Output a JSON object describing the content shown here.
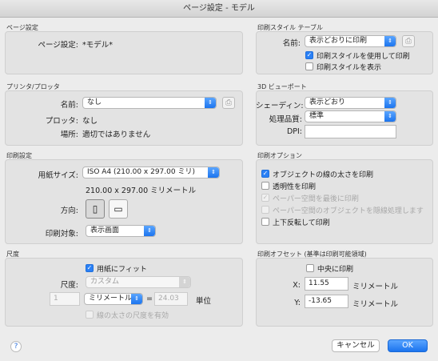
{
  "window": {
    "title": "ページ設定 - モデル"
  },
  "page_setup": {
    "section": "ページ設定",
    "label": "ページ設定:",
    "value": "*モデル*"
  },
  "plot_style": {
    "section": "印刷スタイル テーブル",
    "name_label": "名前:",
    "name_value": "表示どおりに印刷",
    "use_styles": {
      "label": "印刷スタイルを使用して印刷",
      "checked": true
    },
    "show_styles": {
      "label": "印刷スタイルを表示",
      "checked": false
    }
  },
  "printer": {
    "section": "プリンタ/プロッタ",
    "name_label": "名前:",
    "name_value": "なし",
    "plotter_label": "プロッタ:",
    "plotter_value": "なし",
    "location_label": "場所:",
    "location_value": "適切ではありません"
  },
  "viewport3d": {
    "section": "3D ビューポート",
    "shade_label": "シェーディン:",
    "shade_value": "表示どおり",
    "quality_label": "処理品質:",
    "quality_value": "標準",
    "dpi_label": "DPI:",
    "dpi_value": ""
  },
  "print_settings": {
    "section": "印刷設定",
    "paper_label": "用紙サイズ:",
    "paper_value": "ISO A4 (210.00 x 297.00 ミリ)",
    "paper_dims": "210.00 x 297.00 ミリメートル",
    "orientation_label": "方向:",
    "area_label": "印刷対象:",
    "area_value": "表示画面"
  },
  "print_options": {
    "section": "印刷オプション",
    "items": [
      {
        "label": "オブジェクトの線の太さを印刷",
        "checked": true,
        "disabled": false
      },
      {
        "label": "透明性を印刷",
        "checked": false,
        "disabled": false
      },
      {
        "label": "ペーパー空間を最後に印刷",
        "checked": true,
        "disabled": true
      },
      {
        "label": "ペーパー空間のオブジェクトを隠線処理します",
        "checked": false,
        "disabled": true
      },
      {
        "label": "上下反転して印刷",
        "checked": false,
        "disabled": false
      }
    ]
  },
  "scale": {
    "section": "尺度",
    "fit_label": "用紙にフィット",
    "fit_checked": true,
    "scale_label": "尺度:",
    "scale_value": "カスタム",
    "value1": "1",
    "unit_value": "ミリメートル",
    "equals": "=",
    "value2": "24.03",
    "unit_label": "単位",
    "lineweight_label": "線の太さの尺度を有効"
  },
  "offset": {
    "section": "印刷オフセット (基準は印刷可能領域)",
    "center_label": "中央に印刷",
    "center_checked": false,
    "x_label": "X:",
    "x_value": "11.55",
    "x_unit": "ミリメートル",
    "y_label": "Y:",
    "y_value": "-13.65",
    "y_unit": "ミリメートル"
  },
  "footer": {
    "help": "?",
    "cancel": "キャンセル",
    "ok": "OK"
  }
}
